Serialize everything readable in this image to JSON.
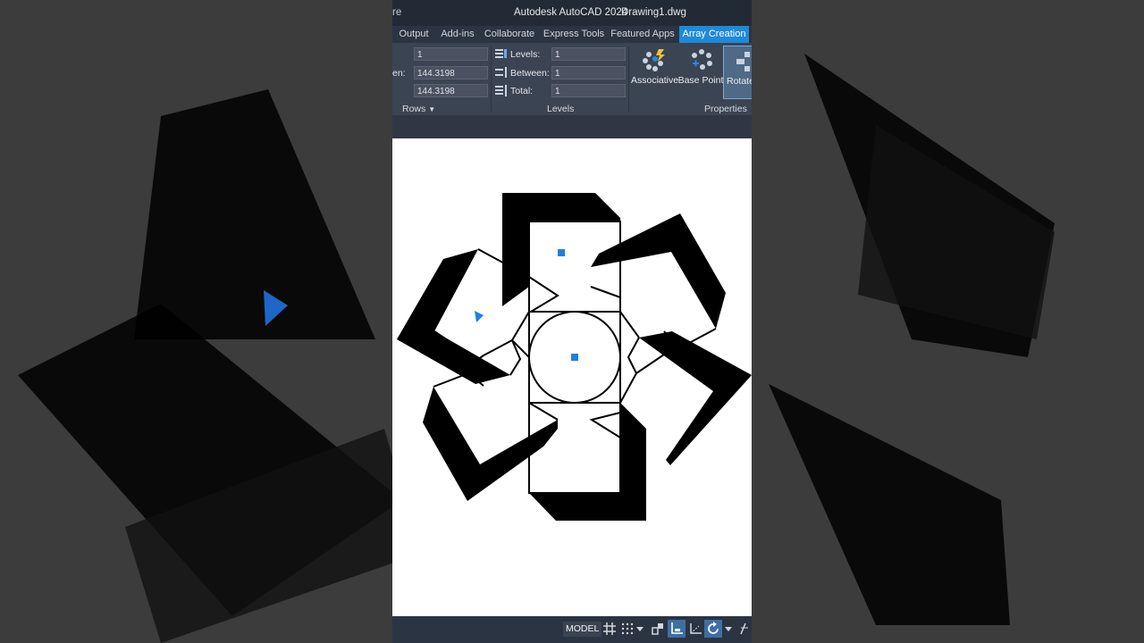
{
  "window": {
    "left_fragment": "re",
    "app_title": "Autodesk AutoCAD 2024",
    "document_title": "Drawing1.dwg"
  },
  "tabs": [
    {
      "label": "Output"
    },
    {
      "label": "Add-ins"
    },
    {
      "label": "Collaborate"
    },
    {
      "label": "Express Tools"
    },
    {
      "label": "Featured Apps"
    },
    {
      "label": "Array Creation",
      "active": true
    }
  ],
  "ribbon": {
    "rows": {
      "count_value": "1",
      "between_label_fragment": "en:",
      "between_value": "144.3198",
      "total_value": "144.3198",
      "panel_label": "Rows"
    },
    "levels": {
      "levels_label": "Levels:",
      "levels_value": "1",
      "between_label": "Between:",
      "between_value": "1",
      "total_label": "Total:",
      "total_value": "1",
      "panel_label": "Levels"
    },
    "properties": {
      "associative_label": "Associative",
      "base_point_label": "Base Point",
      "rotate_label": "Rotate",
      "panel_label": "Properties"
    }
  },
  "statusbar": {
    "model_label": "MODEL"
  },
  "colors": {
    "accent": "#1f8ad8",
    "grip": "#1e7fe0",
    "ribbon_bg": "#3b4453",
    "title_bg": "#222a35"
  }
}
